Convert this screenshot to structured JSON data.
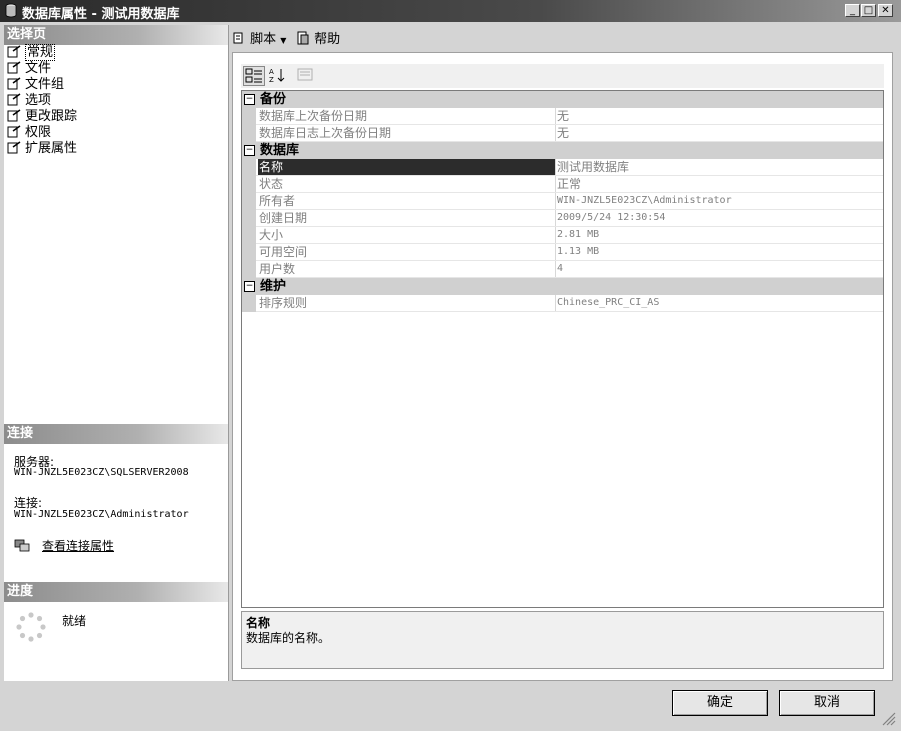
{
  "window": {
    "title": "数据库属性 - 测试用数据库",
    "controls": [
      "_",
      "□",
      "✕"
    ]
  },
  "left": {
    "select_page_header": "选择页",
    "nav_items": [
      {
        "label": "常规",
        "icon": "page-icon"
      },
      {
        "label": "文件",
        "icon": "page-icon"
      },
      {
        "label": "文件组",
        "icon": "page-icon"
      },
      {
        "label": "选项",
        "icon": "page-icon"
      },
      {
        "label": "更改跟踪",
        "icon": "page-icon"
      },
      {
        "label": "权限",
        "icon": "page-icon"
      },
      {
        "label": "扩展属性",
        "icon": "page-icon"
      }
    ],
    "connection_header": "连接",
    "server_label": "服务器:",
    "server_value": "WIN-JNZL5E023CZ\\SQLSERVER2008",
    "connection_label": "连接:",
    "connection_value": "WIN-JNZL5E023CZ\\Administrator",
    "view_connection_link": "查看连接属性",
    "progress_header": "进度",
    "progress_status": "就绪"
  },
  "toolbar": {
    "script_label": "脚本",
    "help_label": "帮助"
  },
  "grid": {
    "categories": [
      {
        "name": "备份",
        "rows": [
          {
            "name": "数据库上次备份日期",
            "value": "无"
          },
          {
            "name": "数据库日志上次备份日期",
            "value": "无"
          }
        ]
      },
      {
        "name": "数据库",
        "rows": [
          {
            "name": "名称",
            "value": "测试用数据库"
          },
          {
            "name": "状态",
            "value": "正常"
          },
          {
            "name": "所有者",
            "value": "WIN-JNZL5E023CZ\\Administrator"
          },
          {
            "name": "创建日期",
            "value": "2009/5/24 12:30:54"
          },
          {
            "name": "大小",
            "value": "2.81 MB"
          },
          {
            "name": "可用空间",
            "value": "1.13 MB"
          },
          {
            "name": "用户数",
            "value": "4"
          }
        ]
      },
      {
        "name": "维护",
        "rows": [
          {
            "name": "排序规则",
            "value": "Chinese_PRC_CI_AS"
          }
        ]
      }
    ]
  },
  "description": {
    "title": "名称",
    "text": "数据库的名称。"
  },
  "buttons": {
    "ok": "确定",
    "cancel": "取消"
  }
}
